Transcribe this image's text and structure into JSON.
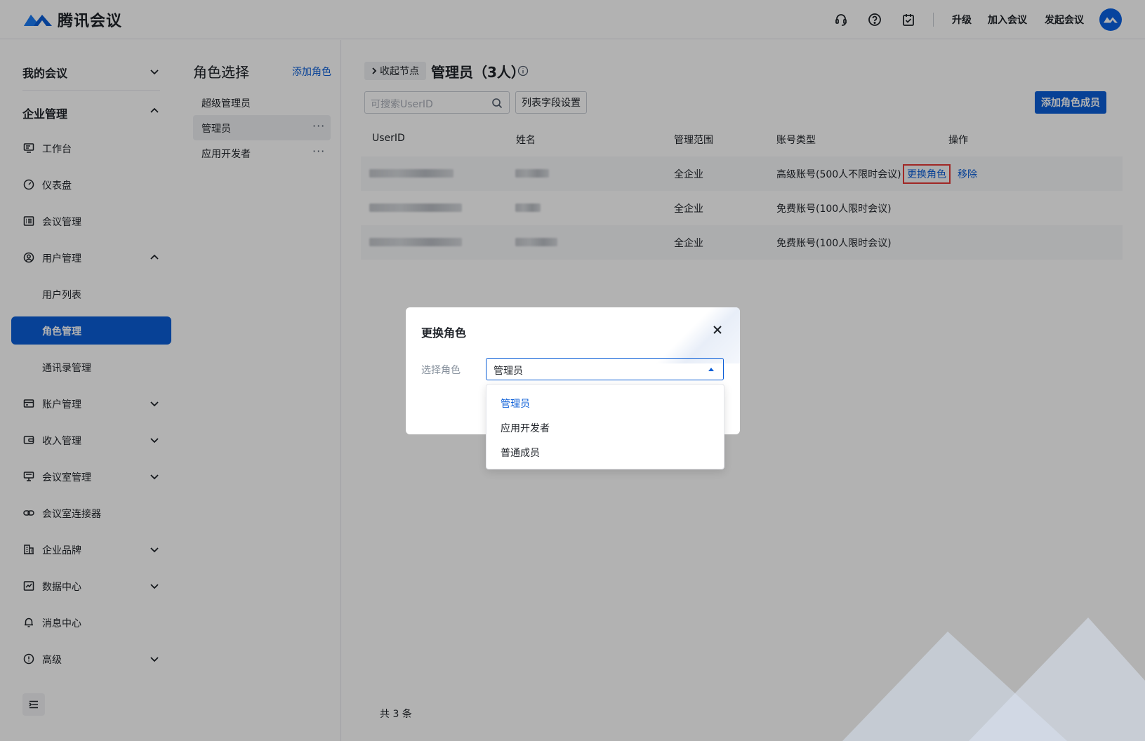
{
  "header": {
    "app_name": "腾讯会议",
    "links": [
      "升级",
      "加入会议",
      "发起会议"
    ],
    "icons": [
      "headset-icon",
      "help-icon",
      "clipboard-check-icon"
    ]
  },
  "sidebar": {
    "my_meetings": "我的会议",
    "enterprise": "企业管理",
    "items": [
      {
        "label": "工作台",
        "icon": "monitor-icon"
      },
      {
        "label": "仪表盘",
        "icon": "gauge-icon"
      },
      {
        "label": "会议管理",
        "icon": "list-icon"
      },
      {
        "label": "用户管理",
        "icon": "user-circle-icon"
      },
      {
        "label": "用户列表",
        "icon": ""
      },
      {
        "label": "角色管理",
        "icon": ""
      },
      {
        "label": "通讯录管理",
        "icon": ""
      },
      {
        "label": "账户管理",
        "icon": "card-icon"
      },
      {
        "label": "收入管理",
        "icon": "wallet-icon"
      },
      {
        "label": "会议室管理",
        "icon": "meeting-room-icon"
      },
      {
        "label": "会议室连接器",
        "icon": "link-icon"
      },
      {
        "label": "企业品牌",
        "icon": "building-icon"
      },
      {
        "label": "数据中心",
        "icon": "chart-icon"
      },
      {
        "label": "消息中心",
        "icon": "bell-icon"
      },
      {
        "label": "高级",
        "icon": "shield-icon"
      }
    ]
  },
  "roles": {
    "title": "角色选择",
    "add": "添加角色",
    "items": [
      "超级管理员",
      "管理员",
      "应用开发者"
    ],
    "more": "···"
  },
  "main": {
    "collapse_node": "收起节点",
    "title": "管理员（3人）",
    "search_placeholder": "可搜索UserID",
    "column_settings": "列表字段设置",
    "add_member": "添加角色成员",
    "columns": [
      "UserID",
      "姓名",
      "管理范围",
      "账号类型",
      "操作"
    ],
    "rows": [
      {
        "scope": "全企业",
        "account_type": "高级账号(500人不限时会议)"
      },
      {
        "scope": "全企业",
        "account_type": "免费账号(100人限时会议)"
      },
      {
        "scope": "全企业",
        "account_type": "免费账号(100人限时会议)"
      }
    ],
    "op_change": "更换角色",
    "op_remove": "移除",
    "total": "共 3 条"
  },
  "modal": {
    "title": "更换角色",
    "label": "选择角色",
    "value": "管理员",
    "options": [
      "管理员",
      "应用开发者",
      "普通成员"
    ]
  },
  "colors": {
    "accent": "#0b5ed7",
    "highlight": "#e53935"
  }
}
